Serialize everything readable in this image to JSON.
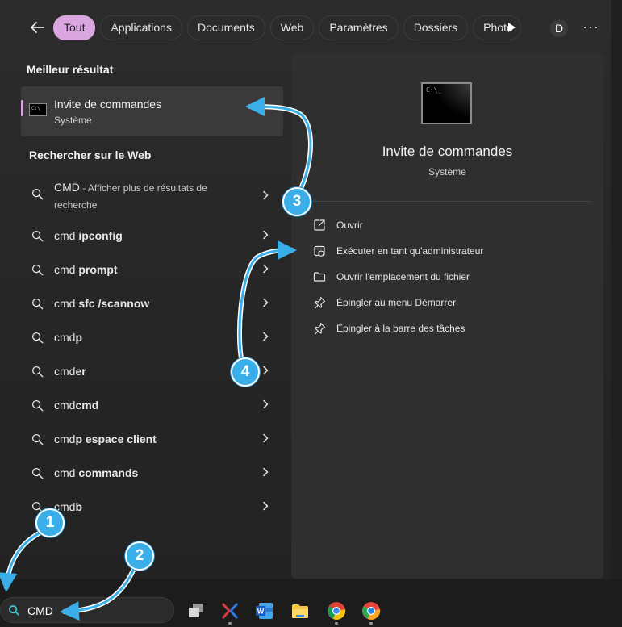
{
  "topbar": {
    "tabs": [
      {
        "label": "Tout",
        "active": true
      },
      {
        "label": "Applications"
      },
      {
        "label": "Documents"
      },
      {
        "label": "Web"
      },
      {
        "label": "Paramètres"
      },
      {
        "label": "Dossiers"
      },
      {
        "label": "Photo"
      }
    ],
    "avatar_letter": "D",
    "more_label": "···"
  },
  "best_match": {
    "section_title": "Meilleur résultat",
    "name": "Invite de commandes",
    "subtitle": "Système",
    "icon": "cmd-console-icon",
    "icon_prompt": "C:\\_"
  },
  "web_search": {
    "section_title": "Rechercher sur le Web",
    "items": [
      {
        "prefix": "CMD",
        "bold": "",
        "description": " - Afficher plus de résultats de recherche"
      },
      {
        "prefix": "cmd ",
        "bold": "ipconfig"
      },
      {
        "prefix": "cmd ",
        "bold": "prompt"
      },
      {
        "prefix": "cmd ",
        "bold": "sfc /scannow"
      },
      {
        "prefix": "cmd",
        "bold": "p"
      },
      {
        "prefix": "cmd",
        "bold": "er"
      },
      {
        "prefix": "cmd",
        "bold": "cmd"
      },
      {
        "prefix": "cmd",
        "bold": "p espace client"
      },
      {
        "prefix": "cmd ",
        "bold": "commands"
      },
      {
        "prefix": "cmd",
        "bold": "b"
      }
    ]
  },
  "preview": {
    "title": "Invite de commandes",
    "subtitle": "Système",
    "icon_prompt": "C:\\_",
    "actions": [
      {
        "label": "Ouvrir",
        "icon": "open-external-icon"
      },
      {
        "label": "Exécuter en tant qu'administrateur",
        "icon": "shield-admin-icon"
      },
      {
        "label": "Ouvrir l'emplacement du fichier",
        "icon": "folder-icon"
      },
      {
        "label": "Épingler au menu Démarrer",
        "icon": "pin-icon"
      },
      {
        "label": "Épingler à la barre des tâches",
        "icon": "pin-icon"
      }
    ]
  },
  "taskbar": {
    "search_value": "CMD",
    "apps": [
      "task-view-icon",
      "visual-studio-icon",
      "word-icon",
      "file-explorer-icon",
      "chrome-icon",
      "chrome-canary-icon"
    ]
  },
  "callouts": [
    "1",
    "2",
    "3",
    "4"
  ],
  "colors": {
    "accent": "#d9a6e0",
    "callout": "#3aaee8",
    "panel": "#2c2c2c",
    "card": "#2f2f2f"
  }
}
